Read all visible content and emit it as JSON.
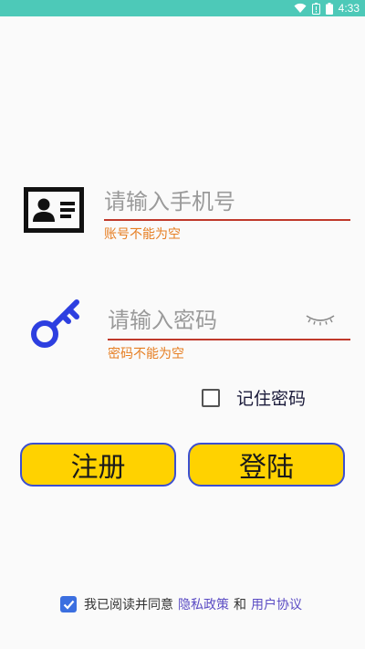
{
  "status_bar": {
    "time": "4:33",
    "icons": [
      "wifi-icon",
      "battery-alert-icon",
      "battery-icon"
    ],
    "background": "#4dc9b8"
  },
  "phone": {
    "placeholder": "请输入手机号",
    "value": "",
    "error": "账号不能为空",
    "icon": "id-card-icon"
  },
  "password": {
    "placeholder": "请输入密码",
    "value": "",
    "error": "密码不能为空",
    "icon": "key-icon",
    "toggle_icon": "eye-closed-icon"
  },
  "remember": {
    "label": "记住密码",
    "checked": false
  },
  "buttons": {
    "register": "注册",
    "login": "登陆"
  },
  "agreement": {
    "checked": true,
    "text": "我已阅读并同意",
    "privacy": "隐私政策",
    "and": "和",
    "terms": "用户协议"
  },
  "colors": {
    "accent_button": "#ffd200",
    "button_border": "#3b4fd1",
    "error": "#e67e22",
    "underline": "#c0392b",
    "link": "#5b4cc4"
  }
}
